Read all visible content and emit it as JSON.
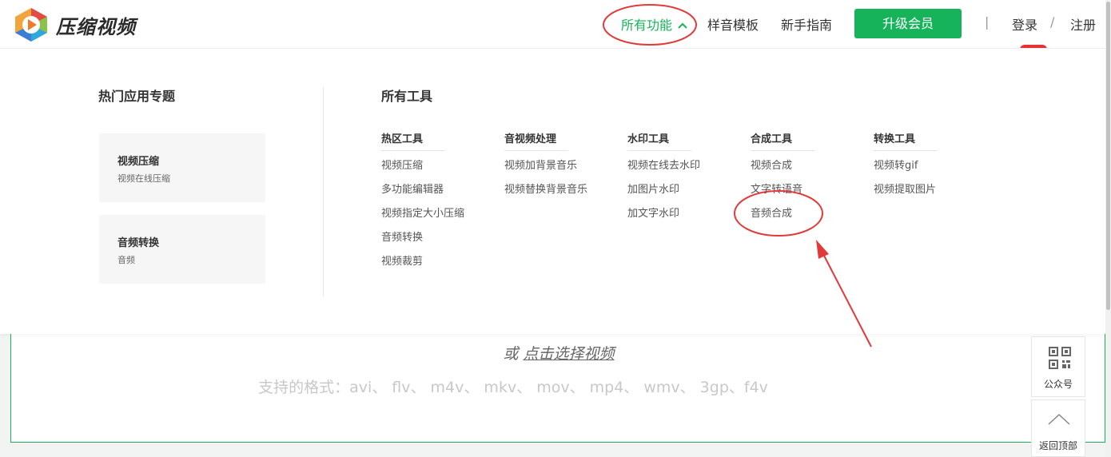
{
  "brand": {
    "name": "压缩视频"
  },
  "nav": {
    "all_features": "所有功能",
    "samples": "样音模板",
    "guide": "新手指南",
    "upgrade": "升级会员",
    "divider": "|",
    "login": "登录",
    "slash": "/",
    "register": "注册"
  },
  "menu": {
    "hot_title": "热门应用专题",
    "hot_cards": [
      {
        "title": "视频压缩",
        "subtitle": "视频在线压缩"
      },
      {
        "title": "音频转换",
        "subtitle": "音频"
      }
    ],
    "tools_title": "所有工具",
    "columns": [
      {
        "title": "热区工具",
        "items": [
          "视频压缩",
          "多功能编辑器",
          "视频指定大小压缩",
          "音频转换",
          "视频裁剪"
        ]
      },
      {
        "title": "音视频处理",
        "items": [
          "视频加背景音乐",
          "视频替换背景音乐"
        ]
      },
      {
        "title": "水印工具",
        "items": [
          "视频在线去水印",
          "加图片水印",
          "加文字水印"
        ]
      },
      {
        "title": "合成工具",
        "items": [
          "视频合成",
          "文字转语音",
          "音频合成"
        ]
      },
      {
        "title": "转换工具",
        "items": [
          "视频转gif",
          "视频提取图片"
        ]
      }
    ]
  },
  "upload": {
    "or": "或",
    "choose_link": "点击选择视频",
    "formats": "支持的格式：avi、 flv、 m4v、 mkv、 mov、 mp4、 wmv、 3gp、f4v"
  },
  "side": {
    "qr_label": "公众号",
    "top_label": "返回顶部"
  },
  "colors": {
    "accent": "#16b35a",
    "annotation": "#e03a3a"
  },
  "icons": {
    "logo": "play-logo-icon",
    "chevron": "chevron-up-icon",
    "qr": "qr-code-icon",
    "back_top": "chevron-up-icon"
  }
}
